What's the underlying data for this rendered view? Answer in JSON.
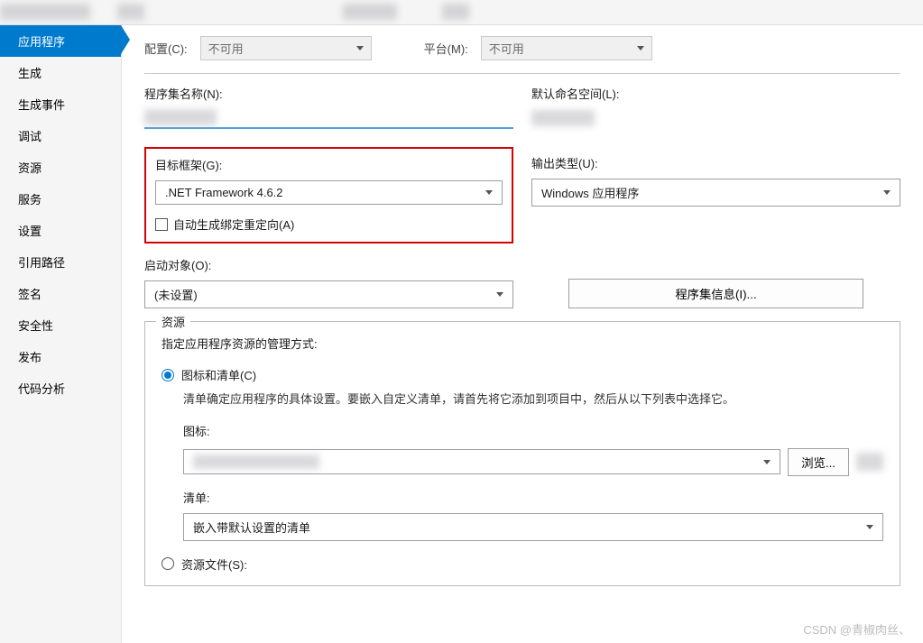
{
  "topbar": {},
  "sidebar": {
    "items": [
      {
        "label": "应用程序"
      },
      {
        "label": "生成"
      },
      {
        "label": "生成事件"
      },
      {
        "label": "调试"
      },
      {
        "label": "资源"
      },
      {
        "label": "服务"
      },
      {
        "label": "设置"
      },
      {
        "label": "引用路径"
      },
      {
        "label": "签名"
      },
      {
        "label": "安全性"
      },
      {
        "label": "发布"
      },
      {
        "label": "代码分析"
      }
    ],
    "active_index": 0
  },
  "config": {
    "config_label": "配置(C):",
    "config_value": "不可用",
    "platform_label": "平台(M):",
    "platform_value": "不可用"
  },
  "fields": {
    "assembly_name_label": "程序集名称(N):",
    "default_namespace_label": "默认命名空间(L):",
    "target_framework_label": "目标框架(G):",
    "target_framework_value": ".NET Framework 4.6.2",
    "output_type_label": "输出类型(U):",
    "output_type_value": "Windows 应用程序",
    "auto_binding_checkbox": "自动生成绑定重定向(A)",
    "startup_object_label": "启动对象(O):",
    "startup_object_value": "(未设置)",
    "assembly_info_btn": "程序集信息(I)..."
  },
  "resources": {
    "title": "资源",
    "description": "指定应用程序资源的管理方式:",
    "radio_icon_manifest": "图标和清单(C)",
    "help_text": "清单确定应用程序的具体设置。要嵌入自定义清单，请首先将它添加到项目中，然后从以下列表中选择它。",
    "icon_label": "图标:",
    "browse_btn": "浏览...",
    "manifest_label": "清单:",
    "manifest_value": "嵌入带默认设置的清单",
    "radio_resource_file": "资源文件(S):"
  },
  "watermark": "CSDN @青椒肉丝、"
}
